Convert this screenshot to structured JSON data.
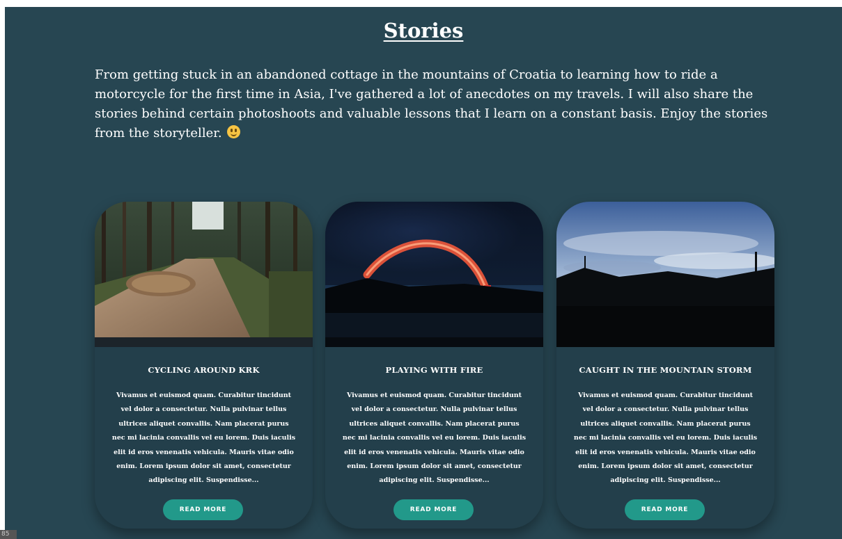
{
  "page": {
    "title": "Stories",
    "intro": "From getting stuck in an abandoned cottage in the mountains of Croatia to learning how to ride a motorcycle for the first time in Asia, I've gathered a lot of anecdotes on my travels. I will also share the stories behind certain photoshoots and valuable lessons that I learn on a constant basis. Enjoy the stories from the storyteller.",
    "intro_icon": "smiley-emoji-icon"
  },
  "colors": {
    "background": "#274652",
    "card": "#233f4b",
    "button": "#22998a",
    "text": "#ffffff"
  },
  "cards": [
    {
      "title": "CYCLING AROUND KRK",
      "excerpt": "Vivamus et euismod quam. Curabitur tincidunt vel dolor a consectetur. Nulla pulvinar tellus ultrices aliquet convallis. Nam placerat purus nec mi lacinia convallis vel eu lorem. Duis iaculis elit id eros venenatis vehicula. Mauris vitae odio enim. Lorem ipsum dolor sit amet, consectetur adipiscing elit. Suspendisse...",
      "button": "READ MORE",
      "image": "muddy-forest-trail-photo"
    },
    {
      "title": "PLAYING WITH FIRE",
      "excerpt": "Vivamus et euismod quam. Curabitur tincidunt vel dolor a consectetur. Nulla pulvinar tellus ultrices aliquet convallis. Nam placerat purus nec mi lacinia convallis vel eu lorem. Duis iaculis elit id eros venenatis vehicula. Mauris vitae odio enim. Lorem ipsum dolor sit amet, consectetur adipiscing elit. Suspendisse...",
      "button": "READ MORE",
      "image": "fire-light-arc-night-photo"
    },
    {
      "title": "CAUGHT IN THE MOUNTAIN STORM",
      "excerpt": "Vivamus et euismod quam. Curabitur tincidunt vel dolor a consectetur. Nulla pulvinar tellus ultrices aliquet convallis. Nam placerat purus nec mi lacinia convallis vel eu lorem. Duis iaculis elit id eros venenatis vehicula. Mauris vitae odio enim. Lorem ipsum dolor sit amet, consectetur adipiscing elit. Suspendisse...",
      "button": "READ MORE",
      "image": "mountain-storm-sky-photo"
    }
  ],
  "corner_tag": "85"
}
